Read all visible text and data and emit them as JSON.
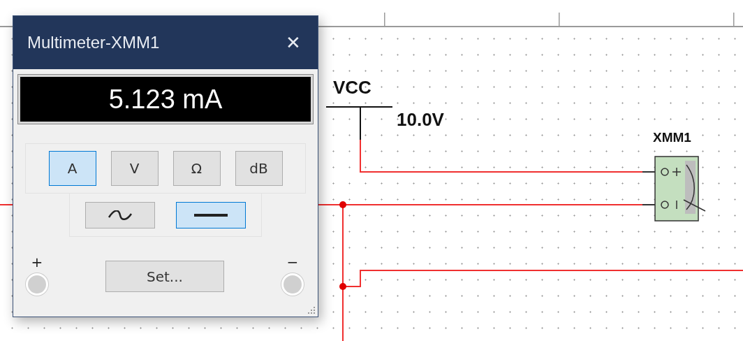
{
  "schematic": {
    "supply_name": "VCC",
    "supply_voltage": "10.0V",
    "instrument_label": "XMM1"
  },
  "multimeter": {
    "title": "Multimeter-XMM1",
    "close": "✕",
    "reading": "5.123 mA",
    "modes": [
      {
        "label": "A",
        "selected": true
      },
      {
        "label": "V",
        "selected": false
      },
      {
        "label": "Ω",
        "selected": false
      },
      {
        "label": "dB",
        "selected": false
      }
    ],
    "coupling": [
      {
        "kind": "ac",
        "selected": false
      },
      {
        "kind": "dc",
        "selected": true
      }
    ],
    "set_button": "Set...",
    "terminals": [
      {
        "label": "+"
      },
      {
        "label": "−"
      }
    ]
  }
}
